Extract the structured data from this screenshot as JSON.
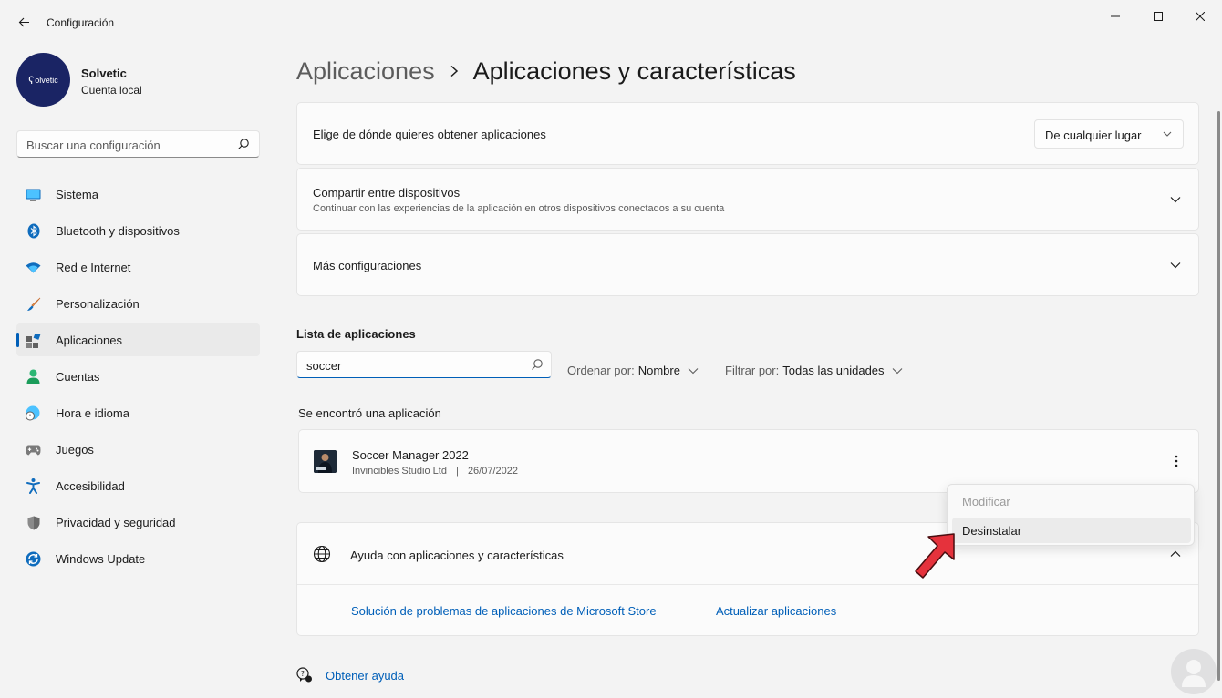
{
  "window": {
    "title": "Configuración"
  },
  "profile": {
    "name": "Solvetic",
    "account_type": "Cuenta local",
    "avatar_text": "olvetic"
  },
  "sidebar": {
    "search_placeholder": "Buscar una configuración",
    "items": [
      {
        "label": "Sistema",
        "icon": "monitor-icon"
      },
      {
        "label": "Bluetooth y dispositivos",
        "icon": "bluetooth-icon"
      },
      {
        "label": "Red e Internet",
        "icon": "wifi-icon"
      },
      {
        "label": "Personalización",
        "icon": "brush-icon"
      },
      {
        "label": "Aplicaciones",
        "icon": "apps-icon",
        "selected": true
      },
      {
        "label": "Cuentas",
        "icon": "person-icon"
      },
      {
        "label": "Hora e idioma",
        "icon": "globe-clock-icon"
      },
      {
        "label": "Juegos",
        "icon": "gamepad-icon"
      },
      {
        "label": "Accesibilidad",
        "icon": "accessibility-icon"
      },
      {
        "label": "Privacidad y seguridad",
        "icon": "shield-icon"
      },
      {
        "label": "Windows Update",
        "icon": "update-icon"
      }
    ]
  },
  "breadcrumb": {
    "parent": "Aplicaciones",
    "current": "Aplicaciones y características"
  },
  "settings": {
    "source": {
      "label": "Elige de dónde quieres obtener aplicaciones",
      "value": "De cualquier lugar"
    },
    "share": {
      "label": "Compartir entre dispositivos",
      "description": "Continuar con las experiencias de la aplicación en otros dispositivos conectados a su cuenta"
    },
    "more": {
      "label": "Más configuraciones"
    }
  },
  "app_list": {
    "title": "Lista de aplicaciones",
    "search_value": "soccer",
    "sort_label": "Ordenar por:",
    "sort_value": "Nombre",
    "filter_label": "Filtrar por:",
    "filter_value": "Todas las unidades",
    "result_text": "Se encontró una aplicación",
    "apps": [
      {
        "name": "Soccer Manager 2022",
        "publisher": "Invincibles Studio Ltd",
        "separator": "|",
        "date": "26/07/2022"
      }
    ]
  },
  "context_menu": {
    "items": [
      {
        "label": "Modificar",
        "enabled": false
      },
      {
        "label": "Desinstalar",
        "enabled": true
      }
    ]
  },
  "help": {
    "title": "Ayuda con aplicaciones y características",
    "links": [
      "Solución de problemas de aplicaciones de Microsoft Store",
      "Actualizar aplicaciones"
    ],
    "get_help": "Obtener ayuda"
  },
  "colors": {
    "accent": "#005fb8",
    "annotation_arrow": "#e5323c"
  }
}
